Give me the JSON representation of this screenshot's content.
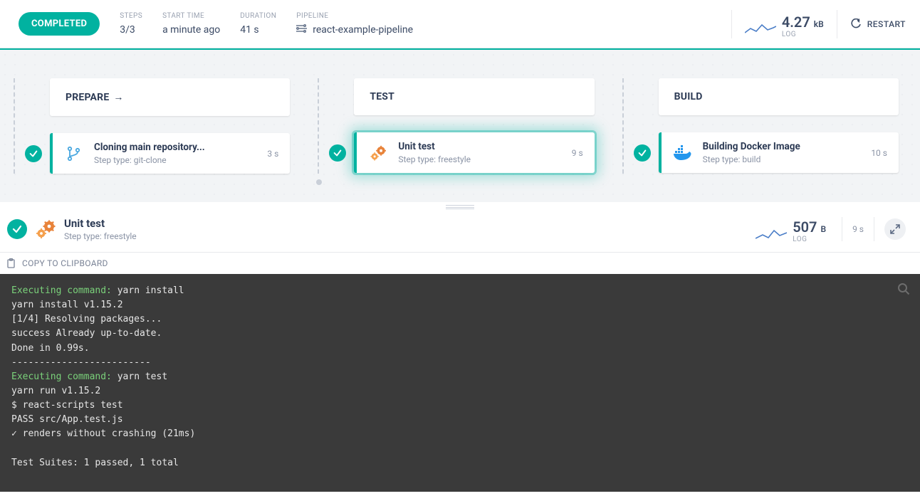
{
  "header": {
    "status_label": "COMPLETED",
    "steps_label": "STEPS",
    "steps_value": "3/3",
    "start_time_label": "START TIME",
    "start_time_value": "a minute ago",
    "duration_label": "DURATION",
    "duration_value": "41 s",
    "pipeline_label": "PIPELINE",
    "pipeline_value": "react-example-pipeline",
    "log_label": "LOG",
    "log_value": "4.27",
    "log_unit": "kB",
    "restart_label": "RESTART"
  },
  "stages": [
    {
      "title": "PREPARE",
      "has_arrow": true,
      "step": {
        "title": "Cloning main repository...",
        "subtitle": "Step type: git-clone",
        "time": "3 s",
        "icon": "git-branch",
        "selected": false
      }
    },
    {
      "title": "TEST",
      "has_arrow": false,
      "step": {
        "title": "Unit test",
        "subtitle": "Step type: freestyle",
        "time": "9 s",
        "icon": "gears",
        "selected": true
      }
    },
    {
      "title": "BUILD",
      "has_arrow": false,
      "step": {
        "title": "Building Docker Image",
        "subtitle": "Step type: build",
        "time": "10 s",
        "icon": "docker",
        "selected": false
      }
    }
  ],
  "detail": {
    "title": "Unit test",
    "subtitle": "Step type: freestyle",
    "log_label": "LOG",
    "log_value": "507",
    "log_unit": "B",
    "time": "9 s"
  },
  "copy_label": "COPY TO CLIPBOARD",
  "terminal_lines": [
    {
      "parts": [
        {
          "class": "t-green",
          "text": "Executing command:"
        },
        {
          "class": "t-white",
          "text": " yarn install"
        }
      ]
    },
    {
      "parts": [
        {
          "class": "t-white",
          "text": "yarn install v1.15.2"
        }
      ]
    },
    {
      "parts": [
        {
          "class": "t-white",
          "text": "[1/4] Resolving packages..."
        }
      ]
    },
    {
      "parts": [
        {
          "class": "t-white",
          "text": "success Already up-to-date."
        }
      ]
    },
    {
      "parts": [
        {
          "class": "t-white",
          "text": "Done in 0.99s."
        }
      ]
    },
    {
      "parts": [
        {
          "class": "t-white",
          "text": "-------------------------"
        }
      ]
    },
    {
      "parts": [
        {
          "class": "t-green",
          "text": "Executing command:"
        },
        {
          "class": "t-white",
          "text": " yarn test"
        }
      ]
    },
    {
      "parts": [
        {
          "class": "t-white",
          "text": "yarn run v1.15.2"
        }
      ]
    },
    {
      "parts": [
        {
          "class": "t-white",
          "text": "$ react-scripts test"
        }
      ]
    },
    {
      "parts": [
        {
          "class": "t-white",
          "text": "PASS src/App.test.js"
        }
      ]
    },
    {
      "parts": [
        {
          "class": "t-white",
          "text": "  ✓ renders without crashing (21ms)"
        }
      ]
    },
    {
      "parts": [
        {
          "class": "t-white",
          "text": ""
        }
      ]
    },
    {
      "parts": [
        {
          "class": "t-white",
          "text": "Test Suites: 1 passed, 1 total"
        }
      ]
    }
  ]
}
